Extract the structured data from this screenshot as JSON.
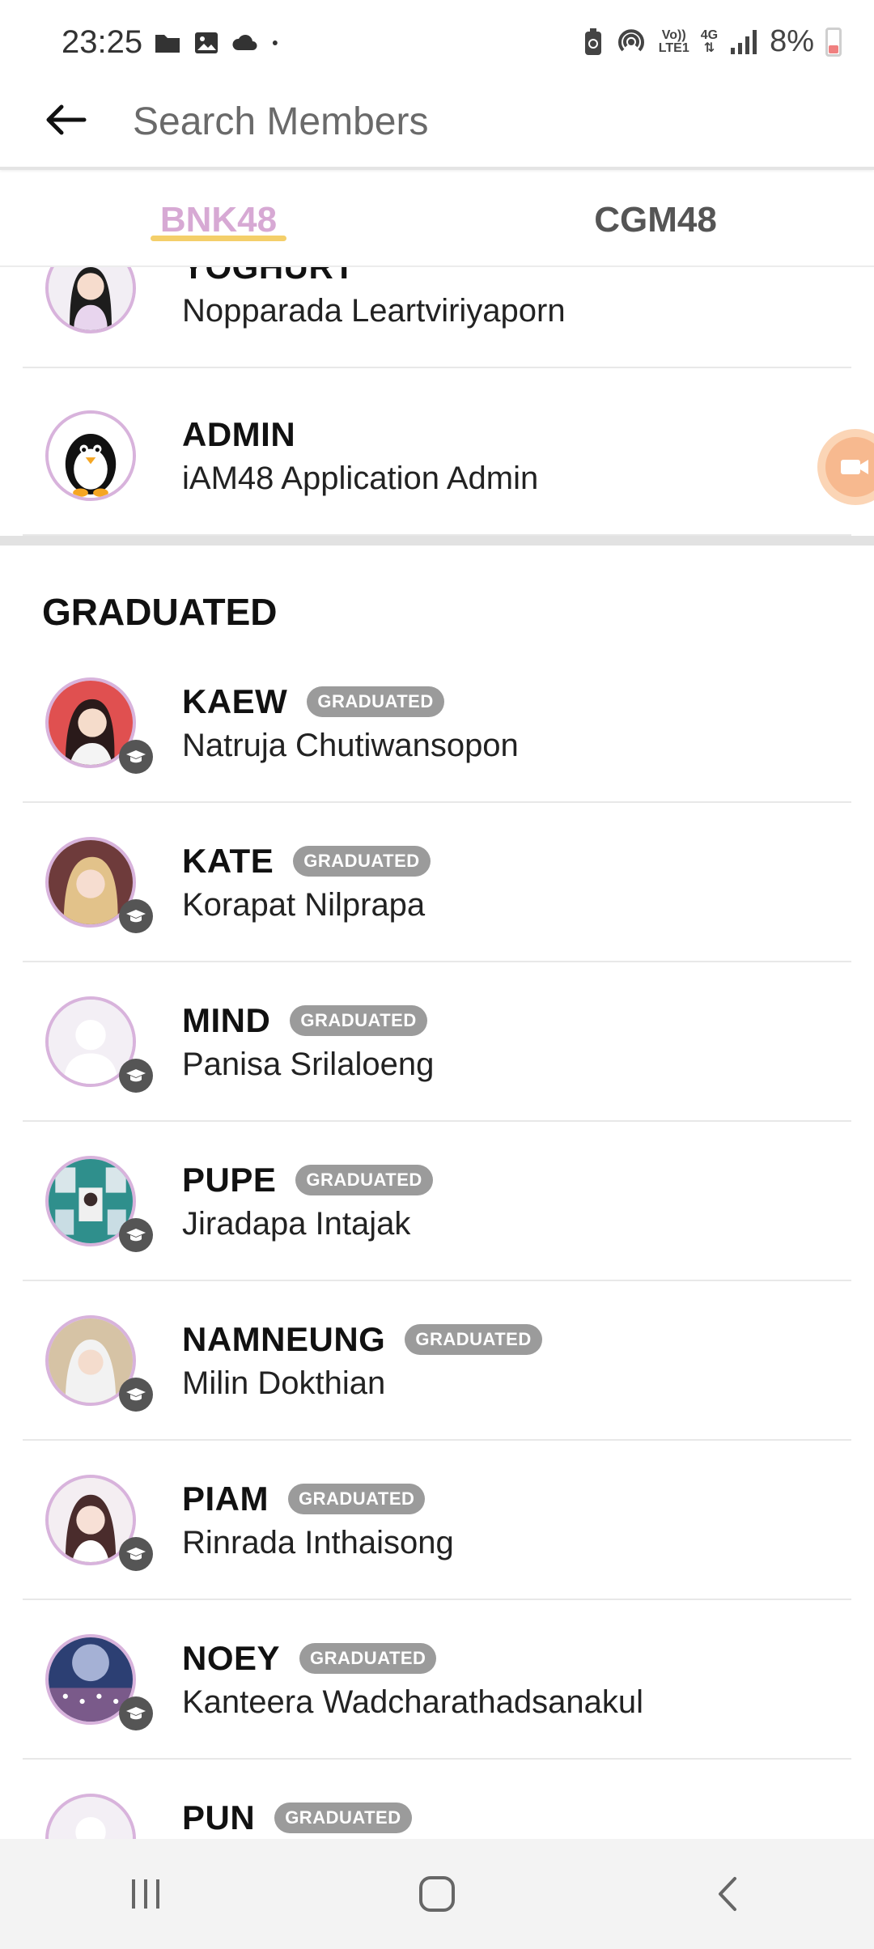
{
  "status_bar": {
    "time": "23:25",
    "battery_text": "8%",
    "left_icons": [
      "folder-icon",
      "image-icon",
      "cloud-icon",
      "dot-icon"
    ],
    "right_icons": [
      "battery-saver-icon",
      "hotspot-icon",
      "volte-icon",
      "4g-icon",
      "signal-icon",
      "battery-icon"
    ],
    "volte_label_top": "Vo))",
    "volte_label_bottom": "LTE1",
    "net_label": "4G"
  },
  "search": {
    "placeholder": "Search Members"
  },
  "tabs": [
    {
      "label": "BNK48",
      "active": true
    },
    {
      "label": "CGM48",
      "active": false
    }
  ],
  "members_top": [
    {
      "nickname": "YOGHURT",
      "fullname": "Nopparada Leartviriyaporn"
    },
    {
      "nickname": "ADMIN",
      "fullname": "iAM48 Application Admin"
    }
  ],
  "graduated_section": {
    "title": "GRADUATED",
    "badge_label": "GRADUATED",
    "members": [
      {
        "nickname": "KAEW",
        "fullname": "Natruja Chutiwansopon"
      },
      {
        "nickname": "KATE",
        "fullname": "Korapat Nilprapa"
      },
      {
        "nickname": "MIND",
        "fullname": "Panisa Srilaloeng"
      },
      {
        "nickname": "PUPE",
        "fullname": "Jiradapa Intajak"
      },
      {
        "nickname": "NAMNEUNG",
        "fullname": "Milin Dokthian"
      },
      {
        "nickname": "PIAM",
        "fullname": "Rinrada Inthaisong"
      },
      {
        "nickname": "NOEY",
        "fullname": "Kanteera Wadcharathadsanakul"
      },
      {
        "nickname": "PUN",
        "fullname": ""
      }
    ]
  },
  "colors": {
    "tab_active": "#d7a9d4",
    "tab_underline": "#f4cf6a",
    "avatar_border": "#d8b3dc",
    "pill_bg": "#9b9b9b",
    "float_badge": "#f7b98f"
  },
  "nav_bar": [
    "recent-apps-icon",
    "home-icon",
    "back-icon"
  ]
}
